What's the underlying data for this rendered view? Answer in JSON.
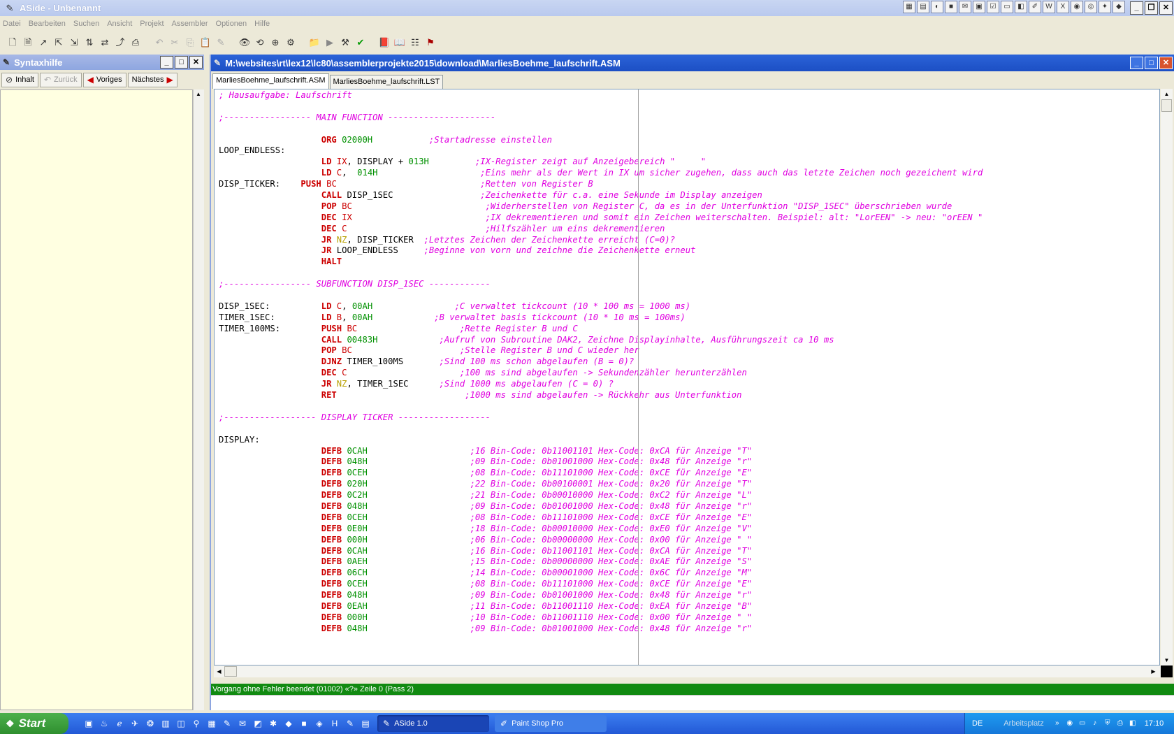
{
  "window": {
    "title": "ASide - Unbenannt"
  },
  "menu": [
    "Datei",
    "Bearbeiten",
    "Suchen",
    "Ansicht",
    "Projekt",
    "Assembler",
    "Optionen",
    "Hilfe"
  ],
  "help_pane": {
    "title": "Syntaxhilfe",
    "buttons": {
      "inhalt": "Inhalt",
      "zurueck": "Zurück",
      "voriges": "Voriges",
      "naechstes": "Nächstes"
    }
  },
  "editor": {
    "title": "M:\\websites\\rt\\lex12\\lc80\\assemblerprojekte2015\\download\\MarliesBoehme_laufschrift.ASM",
    "tabs": [
      "MarliesBoehme_laufschrift.ASM",
      "MarliesBoehme_laufschrift.LST"
    ],
    "active_tab": 0
  },
  "code_lines": [
    [
      [
        "cm",
        "; Hausaufgabe: Laufschrift"
      ]
    ],
    [],
    [
      [
        "cm",
        ";----------------- MAIN FUNCTION ---------------------"
      ]
    ],
    [],
    [
      [
        "t",
        "                    "
      ],
      [
        "kw",
        "ORG"
      ],
      [
        "t",
        " "
      ],
      [
        "num",
        "02000H"
      ],
      [
        "t",
        "           "
      ],
      [
        "cm",
        ";Startadresse einstellen"
      ]
    ],
    [
      [
        "lbl",
        "LOOP_ENDLESS:"
      ]
    ],
    [
      [
        "t",
        "                    "
      ],
      [
        "kw",
        "LD"
      ],
      [
        "t",
        " "
      ],
      [
        "reg",
        "IX"
      ],
      [
        "t",
        ", DISPLAY + "
      ],
      [
        "num",
        "013H"
      ],
      [
        "t",
        "         "
      ],
      [
        "cm",
        ";IX-Register zeigt auf Anzeigebereich \"     \""
      ]
    ],
    [
      [
        "t",
        "                    "
      ],
      [
        "kw",
        "LD"
      ],
      [
        "t",
        " "
      ],
      [
        "reg",
        "C"
      ],
      [
        "t",
        ",  "
      ],
      [
        "num",
        "014H"
      ],
      [
        "t",
        "                    "
      ],
      [
        "cm",
        ";Eins mehr als der Wert in IX um sicher zugehen, dass auch das letzte Zeichen noch gezeichent wird"
      ]
    ],
    [
      [
        "lbl",
        "DISP_TICKER:    "
      ],
      [
        "kw",
        "PUSH"
      ],
      [
        "t",
        " "
      ],
      [
        "reg",
        "BC"
      ],
      [
        "t",
        "                            "
      ],
      [
        "cm",
        ";Retten von Register B"
      ]
    ],
    [
      [
        "t",
        "                    "
      ],
      [
        "kw",
        "CALL"
      ],
      [
        "t",
        " DISP_1SEC                 "
      ],
      [
        "cm",
        ";Zeichenkette für c.a. eine Sekunde im Display anzeigen"
      ]
    ],
    [
      [
        "t",
        "                    "
      ],
      [
        "kw",
        "POP"
      ],
      [
        "t",
        " "
      ],
      [
        "reg",
        "BC"
      ],
      [
        "t",
        "                          "
      ],
      [
        "cm",
        ";Widerherstellen von Register C, da es in der Unterfunktion \"DISP_1SEC\" überschrieben wurde"
      ]
    ],
    [
      [
        "t",
        "                    "
      ],
      [
        "kw",
        "DEC"
      ],
      [
        "t",
        " "
      ],
      [
        "reg",
        "IX"
      ],
      [
        "t",
        "                          "
      ],
      [
        "cm",
        ";IX dekrementieren und somit ein Zeichen weiterschalten. Beispiel: alt: \"LorEEN\" -> neu: \"orEEN \""
      ]
    ],
    [
      [
        "t",
        "                    "
      ],
      [
        "kw",
        "DEC"
      ],
      [
        "t",
        " "
      ],
      [
        "reg",
        "C"
      ],
      [
        "t",
        "                           "
      ],
      [
        "cm",
        ";Hilfszähler um eins dekrementieren"
      ]
    ],
    [
      [
        "t",
        "                    "
      ],
      [
        "kw",
        "JR"
      ],
      [
        "t",
        " "
      ],
      [
        "cc",
        "NZ"
      ],
      [
        "t",
        ", DISP_TICKER  "
      ],
      [
        "cm",
        ";Letztes Zeichen der Zeichenkette erreicht (C=0)?"
      ]
    ],
    [
      [
        "t",
        "                    "
      ],
      [
        "kw",
        "JR"
      ],
      [
        "t",
        " LOOP_ENDLESS     "
      ],
      [
        "cm",
        ";Beginne von vorn und zeichne die Zeichenkette erneut"
      ]
    ],
    [
      [
        "t",
        "                    "
      ],
      [
        "kw",
        "HALT"
      ]
    ],
    [],
    [
      [
        "cm",
        ";----------------- SUBFUNCTION DISP_1SEC ------------"
      ]
    ],
    [],
    [
      [
        "lbl",
        "DISP_1SEC:          "
      ],
      [
        "kw",
        "LD"
      ],
      [
        "t",
        " "
      ],
      [
        "reg",
        "C"
      ],
      [
        "t",
        ", "
      ],
      [
        "num",
        "00AH"
      ],
      [
        "t",
        "                "
      ],
      [
        "cm",
        ";C verwaltet tickcount (10 * 100 ms = 1000 ms)"
      ]
    ],
    [
      [
        "lbl",
        "TIMER_1SEC:         "
      ],
      [
        "kw",
        "LD"
      ],
      [
        "t",
        " "
      ],
      [
        "reg",
        "B"
      ],
      [
        "t",
        ", "
      ],
      [
        "num",
        "00AH"
      ],
      [
        "t",
        "            "
      ],
      [
        "cm",
        ";B verwaltet basis tickcount (10 * 10 ms = 100ms)"
      ]
    ],
    [
      [
        "lbl",
        "TIMER_100MS:        "
      ],
      [
        "kw",
        "PUSH"
      ],
      [
        "t",
        " "
      ],
      [
        "reg",
        "BC"
      ],
      [
        "t",
        "                    "
      ],
      [
        "cm",
        ";Rette Register B und C"
      ]
    ],
    [
      [
        "t",
        "                    "
      ],
      [
        "kw",
        "CALL"
      ],
      [
        "t",
        " "
      ],
      [
        "num",
        "00483H"
      ],
      [
        "t",
        "            "
      ],
      [
        "cm",
        ";Aufruf von Subroutine DAK2, Zeichne Displayinhalte, Ausführungszeit ca 10 ms"
      ]
    ],
    [
      [
        "t",
        "                    "
      ],
      [
        "kw",
        "POP"
      ],
      [
        "t",
        " "
      ],
      [
        "reg",
        "BC"
      ],
      [
        "t",
        "                     "
      ],
      [
        "cm",
        ";Stelle Register B und C wieder her"
      ]
    ],
    [
      [
        "t",
        "                    "
      ],
      [
        "kw",
        "DJNZ"
      ],
      [
        "t",
        " TIMER_100MS       "
      ],
      [
        "cm",
        ";Sind 100 ms schon abgelaufen (B = 0)?"
      ]
    ],
    [
      [
        "t",
        "                    "
      ],
      [
        "kw",
        "DEC"
      ],
      [
        "t",
        " "
      ],
      [
        "reg",
        "C"
      ],
      [
        "t",
        "                      "
      ],
      [
        "cm",
        ";100 ms sind abgelaufen -> Sekundenzähler herunterzählen"
      ]
    ],
    [
      [
        "t",
        "                    "
      ],
      [
        "kw",
        "JR"
      ],
      [
        "t",
        " "
      ],
      [
        "cc",
        "NZ"
      ],
      [
        "t",
        ", TIMER_1SEC      "
      ],
      [
        "cm",
        ";Sind 1000 ms abgelaufen (C = 0) ?"
      ]
    ],
    [
      [
        "t",
        "                    "
      ],
      [
        "kw",
        "RET"
      ],
      [
        "t",
        "                         "
      ],
      [
        "cm",
        ";1000 ms sind abgelaufen -> Rückkehr aus Unterfunktion"
      ]
    ],
    [],
    [
      [
        "cm",
        ";------------------ DISPLAY TICKER ------------------"
      ]
    ],
    [],
    [
      [
        "lbl",
        "DISPLAY:"
      ]
    ],
    [
      [
        "t",
        "                    "
      ],
      [
        "kw",
        "DEFB"
      ],
      [
        "t",
        " "
      ],
      [
        "num",
        "0CAH"
      ],
      [
        "t",
        "                    "
      ],
      [
        "cm",
        ";16 Bin-Code: 0b11001101 Hex-Code: 0xCA für Anzeige \"T\""
      ]
    ],
    [
      [
        "t",
        "                    "
      ],
      [
        "kw",
        "DEFB"
      ],
      [
        "t",
        " "
      ],
      [
        "num",
        "048H"
      ],
      [
        "t",
        "                    "
      ],
      [
        "cm",
        ";09 Bin-Code: 0b01001000 Hex-Code: 0x48 für Anzeige \"r\""
      ]
    ],
    [
      [
        "t",
        "                    "
      ],
      [
        "kw",
        "DEFB"
      ],
      [
        "t",
        " "
      ],
      [
        "num",
        "0CEH"
      ],
      [
        "t",
        "                    "
      ],
      [
        "cm",
        ";08 Bin-Code: 0b11101000 Hex-Code: 0xCE für Anzeige \"E\""
      ]
    ],
    [
      [
        "t",
        "                    "
      ],
      [
        "kw",
        "DEFB"
      ],
      [
        "t",
        " "
      ],
      [
        "num",
        "020H"
      ],
      [
        "t",
        "                    "
      ],
      [
        "cm",
        ";22 Bin-Code: 0b00100001 Hex-Code: 0x20 für Anzeige \"T\""
      ]
    ],
    [
      [
        "t",
        "                    "
      ],
      [
        "kw",
        "DEFB"
      ],
      [
        "t",
        " "
      ],
      [
        "num",
        "0C2H"
      ],
      [
        "t",
        "                    "
      ],
      [
        "cm",
        ";21 Bin-Code: 0b00010000 Hex-Code: 0xC2 für Anzeige \"L\""
      ]
    ],
    [
      [
        "t",
        "                    "
      ],
      [
        "kw",
        "DEFB"
      ],
      [
        "t",
        " "
      ],
      [
        "num",
        "048H"
      ],
      [
        "t",
        "                    "
      ],
      [
        "cm",
        ";09 Bin-Code: 0b01001000 Hex-Code: 0x48 für Anzeige \"r\""
      ]
    ],
    [
      [
        "t",
        "                    "
      ],
      [
        "kw",
        "DEFB"
      ],
      [
        "t",
        " "
      ],
      [
        "num",
        "0CEH"
      ],
      [
        "t",
        "                    "
      ],
      [
        "cm",
        ";08 Bin-Code: 0b11101000 Hex-Code: 0xCE für Anzeige \"E\""
      ]
    ],
    [
      [
        "t",
        "                    "
      ],
      [
        "kw",
        "DEFB"
      ],
      [
        "t",
        " "
      ],
      [
        "num",
        "0E0H"
      ],
      [
        "t",
        "                    "
      ],
      [
        "cm",
        ";18 Bin-Code: 0b00010000 Hex-Code: 0xE0 für Anzeige \"V\""
      ]
    ],
    [
      [
        "t",
        "                    "
      ],
      [
        "kw",
        "DEFB"
      ],
      [
        "t",
        " "
      ],
      [
        "num",
        "000H"
      ],
      [
        "t",
        "                    "
      ],
      [
        "cm",
        ";06 Bin-Code: 0b00000000 Hex-Code: 0x00 für Anzeige \" \""
      ]
    ],
    [
      [
        "t",
        "                    "
      ],
      [
        "kw",
        "DEFB"
      ],
      [
        "t",
        " "
      ],
      [
        "num",
        "0CAH"
      ],
      [
        "t",
        "                    "
      ],
      [
        "cm",
        ";16 Bin-Code: 0b11001101 Hex-Code: 0xCA für Anzeige \"T\""
      ]
    ],
    [
      [
        "t",
        "                    "
      ],
      [
        "kw",
        "DEFB"
      ],
      [
        "t",
        " "
      ],
      [
        "num",
        "0AEH"
      ],
      [
        "t",
        "                    "
      ],
      [
        "cm",
        ";15 Bin-Code: 0b00000000 Hex-Code: 0xAE für Anzeige \"S\""
      ]
    ],
    [
      [
        "t",
        "                    "
      ],
      [
        "kw",
        "DEFB"
      ],
      [
        "t",
        " "
      ],
      [
        "num",
        "06CH"
      ],
      [
        "t",
        "                    "
      ],
      [
        "cm",
        ";14 Bin-Code: 0b00001000 Hex-Code: 0x6C für Anzeige \"M\""
      ]
    ],
    [
      [
        "t",
        "                    "
      ],
      [
        "kw",
        "DEFB"
      ],
      [
        "t",
        " "
      ],
      [
        "num",
        "0CEH"
      ],
      [
        "t",
        "                    "
      ],
      [
        "cm",
        ";08 Bin-Code: 0b11101000 Hex-Code: 0xCE für Anzeige \"E\""
      ]
    ],
    [
      [
        "t",
        "                    "
      ],
      [
        "kw",
        "DEFB"
      ],
      [
        "t",
        " "
      ],
      [
        "num",
        "048H"
      ],
      [
        "t",
        "                    "
      ],
      [
        "cm",
        ";09 Bin-Code: 0b01001000 Hex-Code: 0x48 für Anzeige \"r\""
      ]
    ],
    [
      [
        "t",
        "                    "
      ],
      [
        "kw",
        "DEFB"
      ],
      [
        "t",
        " "
      ],
      [
        "num",
        "0EAH"
      ],
      [
        "t",
        "                    "
      ],
      [
        "cm",
        ";11 Bin-Code: 0b11001110 Hex-Code: 0xEA für Anzeige \"B\""
      ]
    ],
    [
      [
        "t",
        "                    "
      ],
      [
        "kw",
        "DEFB"
      ],
      [
        "t",
        " "
      ],
      [
        "num",
        "000H"
      ],
      [
        "t",
        "                    "
      ],
      [
        "cm",
        ";10 Bin-Code: 0b11001110 Hex-Code: 0x00 für Anzeige \" \""
      ]
    ],
    [
      [
        "t",
        "                    "
      ],
      [
        "kw",
        "DEFB"
      ],
      [
        "t",
        " "
      ],
      [
        "num",
        "048H"
      ],
      [
        "t",
        "                    "
      ],
      [
        "cm",
        ";09 Bin-Code: 0b01001000 Hex-Code: 0x48 für Anzeige \"r\""
      ]
    ]
  ],
  "status": {
    "message": "Vorgang ohne Fehler beendet (01002) «?» Zeile 0 (Pass 2)"
  },
  "taskbar": {
    "start": "Start",
    "tasks": [
      {
        "label": "ASide 1.0",
        "active": true
      },
      {
        "label": "Paint Shop Pro",
        "active": false
      }
    ],
    "lang": "DE",
    "workspace": "Arbeitsplatz",
    "clock": "17:10"
  },
  "colors": {
    "comment": "#e000e0",
    "keyword": "#cc0000",
    "number": "#009000",
    "status_bg": "#118a11",
    "help_bg": "#ffffe1"
  }
}
